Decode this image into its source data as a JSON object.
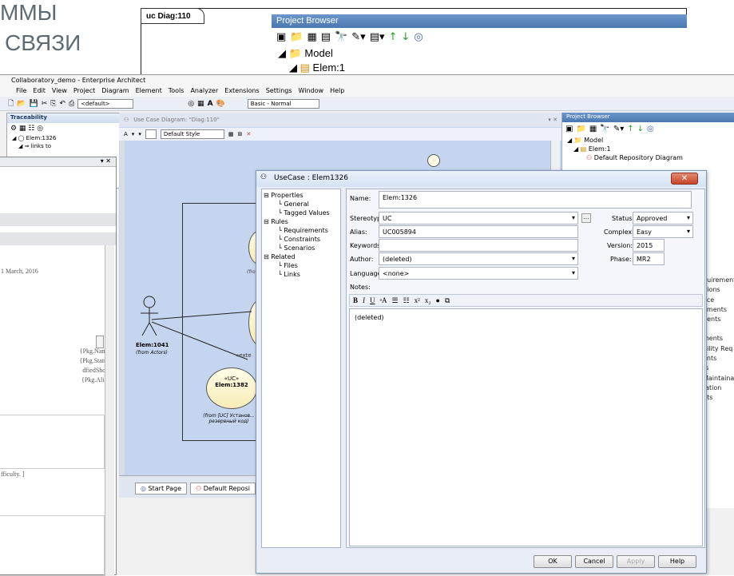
{
  "slide": {
    "title_line1": "ММЫ",
    "title_line2": "СВЯЗИ",
    "diagram_tab": "uc Diag:110"
  },
  "project_browser_top": {
    "title": "Project Browser",
    "tree": [
      "Model",
      "Elem:1"
    ]
  },
  "window": {
    "title": "Collaboratory_demo - Enterprise Architect",
    "menu": [
      "File",
      "Edit",
      "View",
      "Project",
      "Diagram",
      "Element",
      "Tools",
      "Analyzer",
      "Extensions",
      "Settings",
      "Window",
      "Help"
    ],
    "toolbar": {
      "default_combo": "<default>",
      "workspace_combo": "Basic - Normal"
    }
  },
  "traceability": {
    "title": "Traceability",
    "items": [
      "Elem:1326",
      "links to"
    ]
  },
  "doc_window": {
    "date_text": "1 March, 2016",
    "fields": [
      "{Pkg.Name}",
      "{Pkg.Status}",
      "dfiedShort}",
      "{Pkg.Alias}"
    ],
    "difficulty_text": "fficulty. ]"
  },
  "diagram": {
    "tab": "Use Case Diagram: \"Diag:110\"",
    "style_combo": "Default Style",
    "actor_name": "Elem:1041",
    "actor_note": "(from Actors)",
    "uc_stereotype": "«UC»",
    "uc_name": "Elem:1382",
    "uc_note": "(from [UC] Установ... резервный код)",
    "from_text": "(fro",
    "extend_text": "«exte",
    "bottom_tabs": [
      "Start Page",
      "Default Reposi"
    ]
  },
  "project_browser_right": {
    "title": "Project Browser",
    "tree": [
      "Model",
      "Elem:1",
      "Default Repository Diagram"
    ],
    "truncated_items": [
      "quirements",
      "itions",
      "ace",
      "ements",
      "nents",
      "",
      "ments",
      "bility Req",
      "ents",
      "ts",
      "Maintainab",
      "tation",
      "nts"
    ]
  },
  "dialog": {
    "title": "UseCase : Elem1326",
    "tree": [
      "Properties",
      "General",
      "Tagged Values",
      "Rules",
      "Requirements",
      "Constraints",
      "Scenarios",
      "Related",
      "Files",
      "Links"
    ],
    "labels": {
      "name": "Name:",
      "stereotype": "Stereotype:",
      "alias": "Alias:",
      "keywords": "Keywords:",
      "author": "Author:",
      "language": "Language:",
      "notes": "Notes:",
      "status": "Status:",
      "complexity": "Complexity:",
      "version": "Version:",
      "phase": "Phase:"
    },
    "values": {
      "name": "Elem:1326",
      "stereotype": "UC",
      "alias": "UC005894",
      "keywords": "",
      "author": "(deleted)",
      "language": "<none>",
      "status": "Approved",
      "complexity": "Easy",
      "version": "2015",
      "phase": "MR2",
      "notes": "(deleted)"
    },
    "buttons": {
      "ok": "OK",
      "cancel": "Cancel",
      "apply": "Apply",
      "help": "Help"
    },
    "colors": {
      "close_button": "#c6462a"
    }
  }
}
